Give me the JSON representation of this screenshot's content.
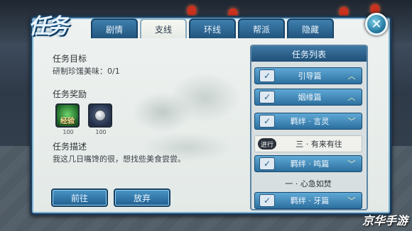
{
  "window": {
    "logo_text": "任务"
  },
  "tabs": [
    {
      "label": "剧情"
    },
    {
      "label": "支线",
      "active": true
    },
    {
      "label": "环线"
    },
    {
      "label": "帮派"
    },
    {
      "label": "隐藏"
    }
  ],
  "quest": {
    "goal_label": "任务目标",
    "goal_value": "研制珍馐美味：0/1",
    "reward_label": "任务奖励",
    "rewards": [
      {
        "name": "经验",
        "count": "100"
      },
      {
        "name": "silver-coins",
        "count": "100"
      }
    ],
    "desc_label": "任务描述",
    "desc_value": "我这几日嘴馋的很，想找些美食尝尝。"
  },
  "buttons": {
    "go": "前往",
    "abandon": "放弃"
  },
  "task_list": {
    "title": "任务列表",
    "rows": [
      {
        "type": "group",
        "label": "引导篇",
        "chevron": "up"
      },
      {
        "type": "group",
        "label": "姻缘篇",
        "chevron": "up"
      },
      {
        "type": "group",
        "label": "羁绊 · 言灵",
        "chevron": "down"
      },
      {
        "type": "quest",
        "label": "三 · 有来有往",
        "mark": "进行"
      },
      {
        "type": "group",
        "label": "羁绊 · 鸣篇",
        "chevron": "down"
      },
      {
        "type": "sub",
        "label": "一 · 心急如焚"
      },
      {
        "type": "group",
        "label": "羁绊 · 牙篇",
        "chevron": "down"
      }
    ]
  },
  "watermark": "京华手游",
  "colors": {
    "accent": "#2c6f9e",
    "panel": "#e6ebe6"
  }
}
